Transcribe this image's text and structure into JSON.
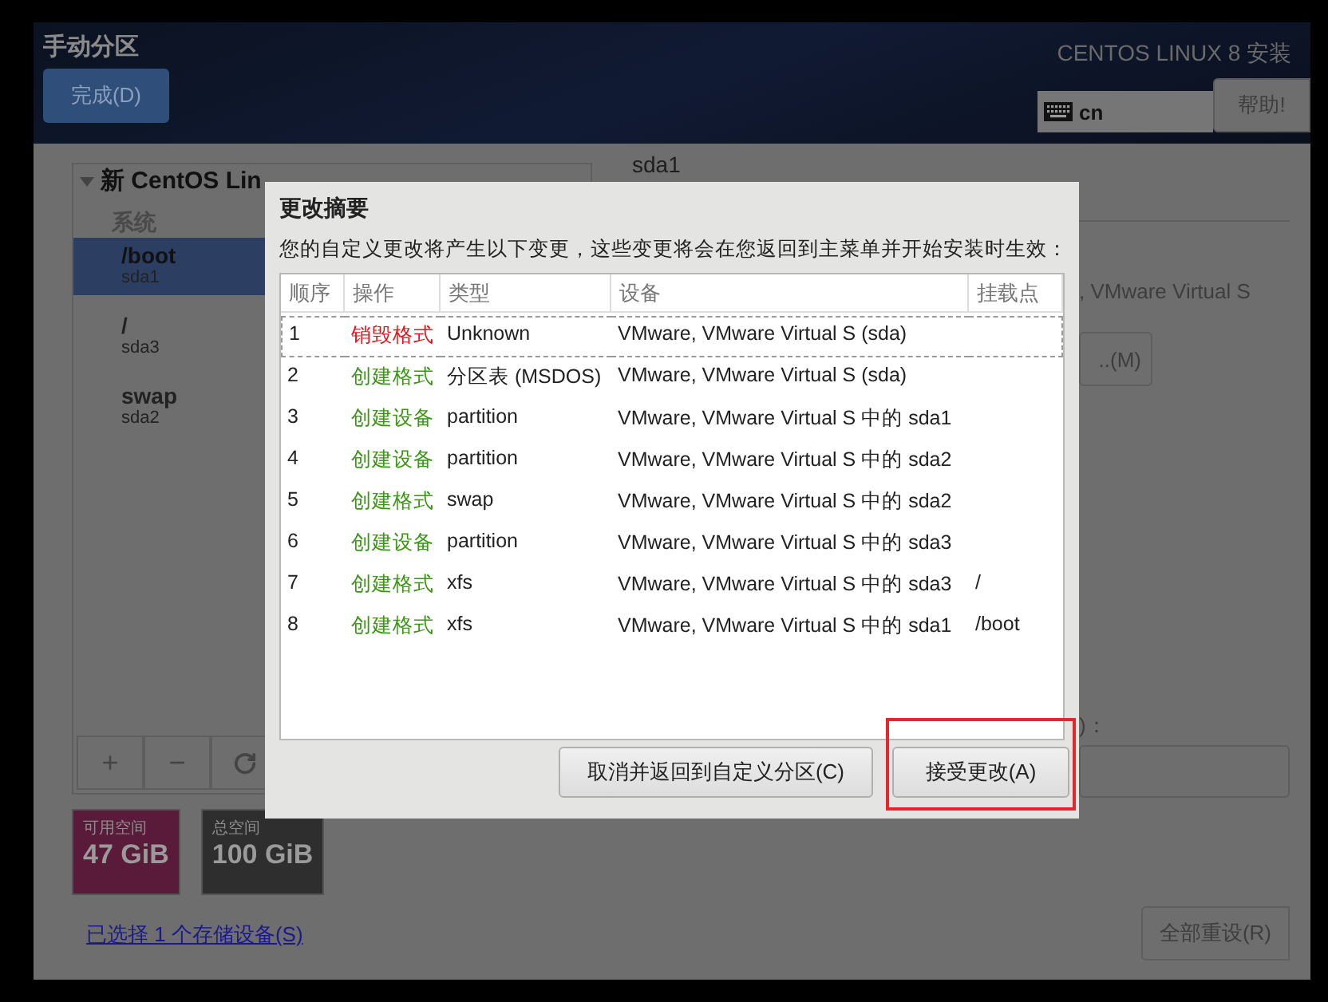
{
  "header": {
    "title": "手动分区",
    "done_button": "完成(D)",
    "product": "CENTOS LINUX 8 安装",
    "keyboard_layout": "cn",
    "help_button": "帮助!"
  },
  "tree": {
    "heading": "新 CentOS Lin",
    "groups": [
      {
        "label": "系统",
        "items": [
          {
            "mount": "/boot",
            "device": "sda1",
            "selected": true
          },
          {
            "mount": "/",
            "device": "sda3",
            "selected": false
          },
          {
            "mount": "swap",
            "device": "sda2",
            "selected": false
          }
        ]
      }
    ]
  },
  "toolbar": {
    "add": "+",
    "remove": "−"
  },
  "storage": [
    {
      "label": "可用空间",
      "value": "47 GiB",
      "color": "#5a1a3a"
    },
    {
      "label": "总空间",
      "value": "100 GiB",
      "color": "#2e2e2e"
    }
  ],
  "storage_link": "已选择 1 个存储设备(S)",
  "reset_button": "全部重设(R)",
  "detail": {
    "title": "sda1",
    "device_text": ", VMware Virtual S",
    "modify_button": "..(M)",
    "field_label": ")："
  },
  "dialog": {
    "title": "更改摘要",
    "message": "您的自定义更改将产生以下变更，这些变更将会在您返回到主菜单并开始安装时生效：",
    "columns": [
      "顺序",
      "操作",
      "类型",
      "设备",
      "挂载点"
    ],
    "rows": [
      {
        "order": "1",
        "action": "销毁格式",
        "color": "#e0141c",
        "type": "Unknown",
        "device": "VMware, VMware Virtual S (sda)",
        "focused": true
      },
      {
        "order": "2",
        "action": "创建格式",
        "color": "#3a9614",
        "type": "分区表 (MSDOS)",
        "device": "VMware, VMware Virtual S (sda)",
        "focused": false
      },
      {
        "order": "3",
        "action": "创建设备",
        "color": "#3a9614",
        "type": "partition",
        "device": "VMware, VMware Virtual S 中的 sda1",
        "focused": false
      },
      {
        "order": "4",
        "action": "创建设备",
        "color": "#3a9614",
        "type": "partition",
        "device": "VMware, VMware Virtual S 中的 sda2",
        "focused": false
      },
      {
        "order": "5",
        "action": "创建格式",
        "color": "#3a9614",
        "type": "swap",
        "device": "VMware, VMware Virtual S 中的 sda2",
        "focused": false
      },
      {
        "order": "6",
        "action": "创建设备",
        "color": "#3a9614",
        "type": "partition",
        "device": "VMware, VMware Virtual S 中的 sda3",
        "focused": false
      },
      {
        "order": "7",
        "action": "创建格式",
        "color": "#3a9614",
        "type": "xfs",
        "device": "VMware, VMware Virtual S 中的 sda3",
        "mount": "/",
        "focused": false
      },
      {
        "order": "8",
        "action": "创建格式",
        "color": "#3a9614",
        "type": "xfs",
        "device": "VMware, VMware Virtual S 中的 sda1",
        "mount": "/boot",
        "focused": false
      }
    ],
    "buttons": [
      {
        "label": "取消并返回到自定义分区(C)",
        "highlighted": false
      },
      {
        "label": "接受更改(A)",
        "highlighted": true
      }
    ]
  }
}
